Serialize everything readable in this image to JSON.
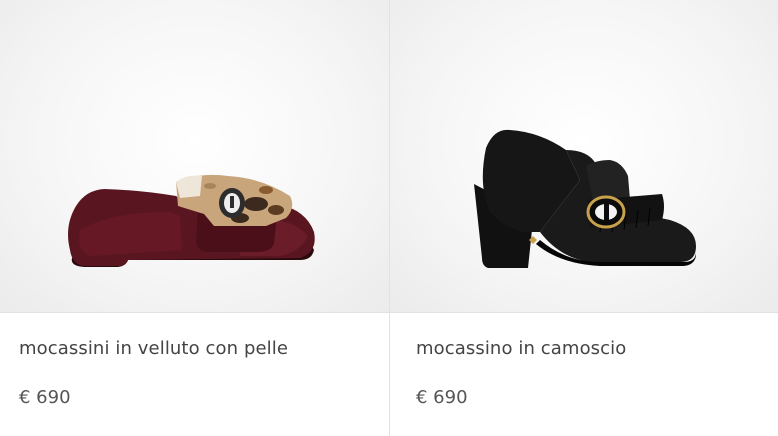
{
  "products": [
    {
      "name": "mocassini in velluto con pelle",
      "price": "€ 690",
      "image_icon": "velvet-loafer-image",
      "color": "#5a1620"
    },
    {
      "name": "mocassino in camoscio",
      "price": "€ 690",
      "image_icon": "suede-pump-image",
      "color": "#121212"
    }
  ]
}
